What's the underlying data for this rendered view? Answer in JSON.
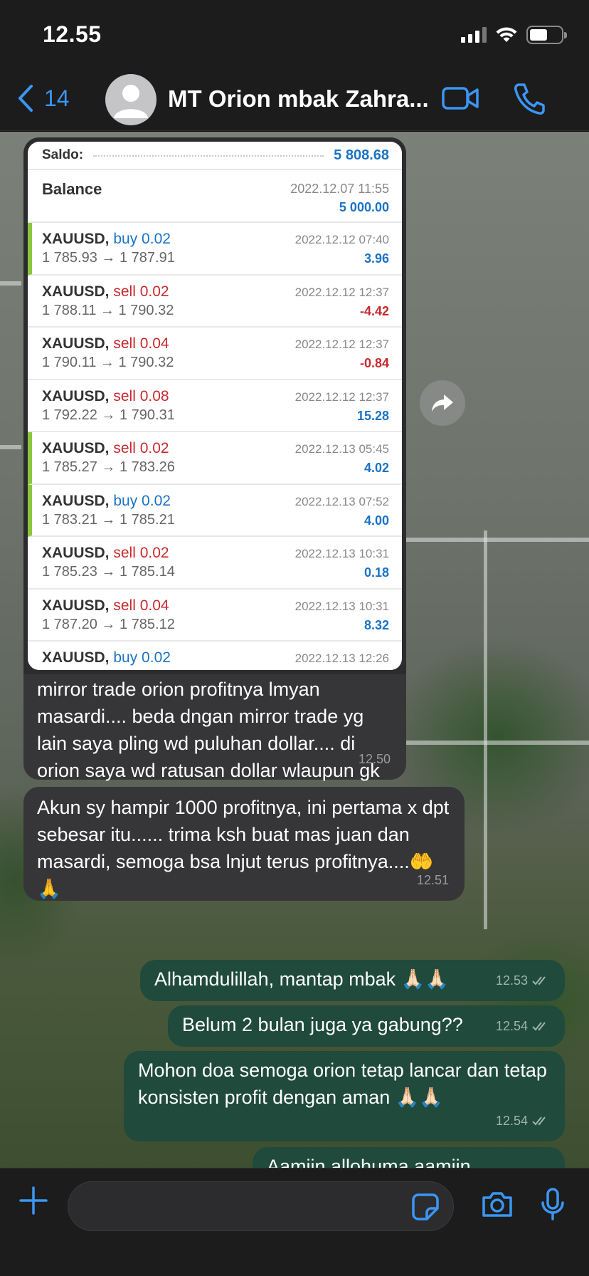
{
  "status": {
    "time": "12.55"
  },
  "header": {
    "back_count": "14",
    "title": "MT Orion mbak Zahra..."
  },
  "screenshot": {
    "saldo_label": "Saldo:",
    "saldo_value": "5 808.68",
    "balance": {
      "label": "Balance",
      "date": "2022.12.07 11:55",
      "amount": "5 000.00"
    },
    "trades": [
      {
        "symbol": "XAUUSD,",
        "side": "buy 0.02",
        "type": "buy",
        "prices": "1 785.93 → 1 787.91",
        "date": "2022.12.12 07:40",
        "pnl": "3.96",
        "sign": "pos",
        "marked": true
      },
      {
        "symbol": "XAUUSD,",
        "side": "sell 0.02",
        "type": "sell",
        "prices": "1 788.11 → 1 790.32",
        "date": "2022.12.12 12:37",
        "pnl": "-4.42",
        "sign": "neg",
        "marked": false
      },
      {
        "symbol": "XAUUSD,",
        "side": "sell 0.04",
        "type": "sell",
        "prices": "1 790.11 → 1 790.32",
        "date": "2022.12.12 12:37",
        "pnl": "-0.84",
        "sign": "neg",
        "marked": false
      },
      {
        "symbol": "XAUUSD,",
        "side": "sell 0.08",
        "type": "sell",
        "prices": "1 792.22 → 1 790.31",
        "date": "2022.12.12 12:37",
        "pnl": "15.28",
        "sign": "pos",
        "marked": false
      },
      {
        "symbol": "XAUUSD,",
        "side": "sell 0.02",
        "type": "sell",
        "prices": "1 785.27 → 1 783.26",
        "date": "2022.12.13 05:45",
        "pnl": "4.02",
        "sign": "pos",
        "marked": true
      },
      {
        "symbol": "XAUUSD,",
        "side": "buy 0.02",
        "type": "buy",
        "prices": "1 783.21 → 1 785.21",
        "date": "2022.12.13 07:52",
        "pnl": "4.00",
        "sign": "pos",
        "marked": true
      },
      {
        "symbol": "XAUUSD,",
        "side": "sell 0.02",
        "type": "sell",
        "prices": "1 785.23 → 1 785.14",
        "date": "2022.12.13 10:31",
        "pnl": "0.18",
        "sign": "pos",
        "marked": false
      },
      {
        "symbol": "XAUUSD,",
        "side": "sell 0.04",
        "type": "sell",
        "prices": "1 787.20 → 1 785.12",
        "date": "2022.12.13 10:31",
        "pnl": "8.32",
        "sign": "pos",
        "marked": false
      },
      {
        "symbol": "XAUUSD,",
        "side": "buy 0.02",
        "type": "buy",
        "prices": "",
        "date": "2022.12.13 12:26",
        "pnl": "",
        "sign": "pos",
        "marked": false
      }
    ]
  },
  "messages": [
    {
      "direction": "in",
      "text": "mirror trade orion profitnya lmyan masardi.... beda dngan mirror trade yg lain saya pling wd puluhan dollar.... di orion saya wd ratusan dollar wlaupun gk selalu bsar.....",
      "time": "12.50"
    },
    {
      "direction": "in",
      "text": "Akun sy hampir 1000 profitnya, ini pertama x dpt sebesar itu...... trima ksh buat mas juan dan masardi, semoga bsa lnjut terus profitnya....🤲🙏",
      "time": "12.51"
    },
    {
      "direction": "out",
      "text": "Alhamdulillah, mantap mbak 🙏🏻🙏🏻",
      "time": "12.53"
    },
    {
      "direction": "out",
      "text": "Belum 2 bulan juga ya gabung??",
      "time": "12.54"
    },
    {
      "direction": "out",
      "text": "Mohon doa semoga orion tetap lancar dan tetap konsisten profit dengan aman 🙏🏻🙏🏻",
      "time": "12.54"
    },
    {
      "direction": "out",
      "text": "Aamiin allohuma aamiin",
      "time": ""
    }
  ],
  "icons": [
    "back-chevron-icon",
    "avatar-icon",
    "video-call-icon",
    "phone-icon",
    "forward-icon",
    "plus-icon",
    "sticker-icon",
    "camera-icon",
    "microphone-icon",
    "read-receipt-icon"
  ],
  "colors": {
    "accent": "#3b96f5",
    "incoming": "#363638",
    "outgoing": "#1f4a3c",
    "buy": "#1c73c4",
    "sell": "#c9282d"
  }
}
